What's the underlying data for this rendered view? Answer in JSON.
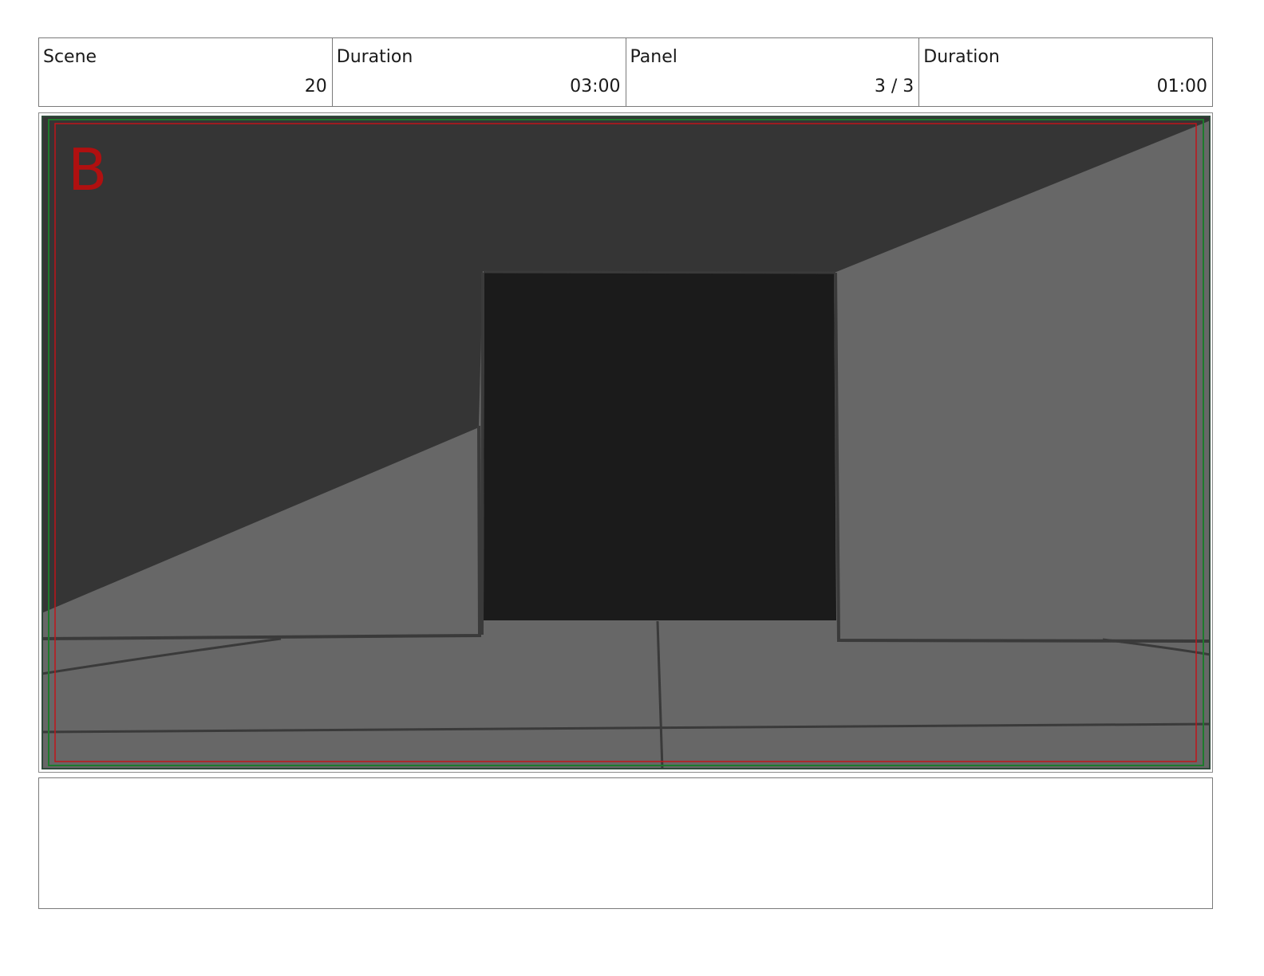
{
  "header": {
    "scene": {
      "label": "Scene",
      "value": "20"
    },
    "scene_duration": {
      "label": "Duration",
      "value": "03:00"
    },
    "panel": {
      "label": "Panel",
      "value": "3 / 3"
    },
    "panel_duration": {
      "label": "Duration",
      "value": "01:00"
    }
  },
  "panel_image": {
    "layer_letter": "B",
    "colors": {
      "ceiling": "#353535",
      "wall": "#676767",
      "doorway": "#1b1b1b",
      "outline": "#3a3a3a",
      "safe_frame_red": "#c0151a",
      "safe_frame_green": "#1d7a2c"
    }
  },
  "notes": {
    "text": ""
  }
}
